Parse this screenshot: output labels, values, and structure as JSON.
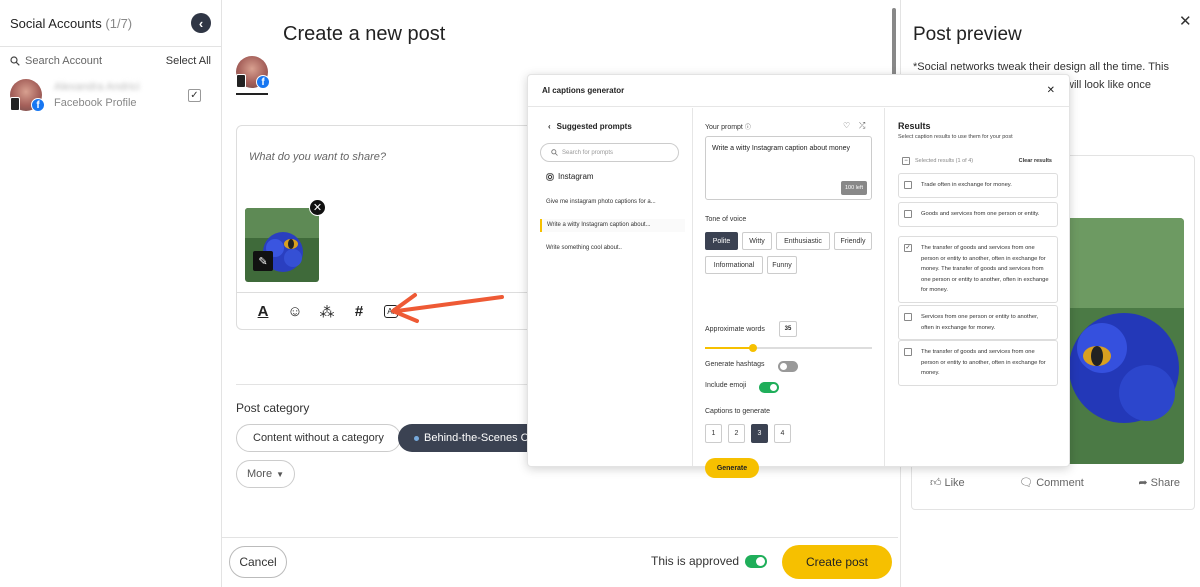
{
  "sidebar": {
    "title": "Social Accounts",
    "count": "(1/7)",
    "search_placeholder": "Search Account",
    "select_all": "Select All",
    "account": {
      "name": "Alexandra Andrici",
      "type": "Facebook Profile",
      "checked": true
    }
  },
  "main": {
    "title": "Create a new post",
    "composer_placeholder": "What do you want to share?",
    "post_category_label": "Post category",
    "categories": [
      "Content without a category",
      "Behind-the-Scenes Conte"
    ],
    "more_label": "More",
    "toolbar": {
      "ai_label": "AI",
      "hashtag": "#"
    }
  },
  "footer": {
    "cancel": "Cancel",
    "approved_label": "This is approved",
    "create": "Create post"
  },
  "preview": {
    "title": "Post preview",
    "note_line1": "*Social networks tweak their design all the time. This",
    "note_line2": "is will look like once",
    "like": "Like",
    "comment": "Comment",
    "share": "Share"
  },
  "modal": {
    "title": "AI captions generator",
    "suggested_header": "Suggested prompts",
    "search_placeholder": "Search for prompts",
    "platform": "Instagram",
    "prompts": [
      "Give me instagram photo captions for a...",
      "Write a witty Instagram caption about...",
      "Write something cool about.."
    ],
    "your_prompt_label": "Your prompt",
    "prompt_text": "Write a witty Instagram caption about money",
    "chars_left": "100 left",
    "tone_label": "Tone of voice",
    "tones": [
      "Polite",
      "Witty",
      "Enthusiastic",
      "Friendly",
      "Informational",
      "Funny"
    ],
    "selected_tone": "Polite",
    "words_label": "Approximate words",
    "words_value": "35",
    "words_fraction": 0.29,
    "hashtags_label": "Generate hashtags",
    "hashtags_on": false,
    "emoji_label": "Include emoji",
    "emoji_on": true,
    "captions_label": "Captions to generate",
    "caption_counts": [
      "1",
      "2",
      "3",
      "4"
    ],
    "selected_count": "3",
    "generate": "Generate",
    "results_title": "Results",
    "results_sub": "Select caption results to use them for your post",
    "selected_results": "Selected results (1 of 4)",
    "clear_results": "Clear results",
    "results": [
      {
        "text": "Trade often in exchange for money.",
        "checked": false
      },
      {
        "text": "Goods and services from one person or entity.",
        "checked": false
      },
      {
        "text": "The transfer of goods and services from one person or entity to another, often in exchange for money. The transfer of goods and services from one person or entity to another, often in exchange for money.",
        "checked": true
      },
      {
        "text": "Services from one person or entity to another, often in exchange for money.",
        "checked": false
      },
      {
        "text": "The transfer of goods and services from one person or entity to another, often in exchange for money.",
        "checked": false
      }
    ]
  },
  "colors": {
    "accent_yellow": "#f6c000",
    "dark_chip": "#3b4252",
    "toggle_green": "#1fae5a",
    "facebook_blue": "#1877f2",
    "arrow_red": "#ee5a35"
  }
}
